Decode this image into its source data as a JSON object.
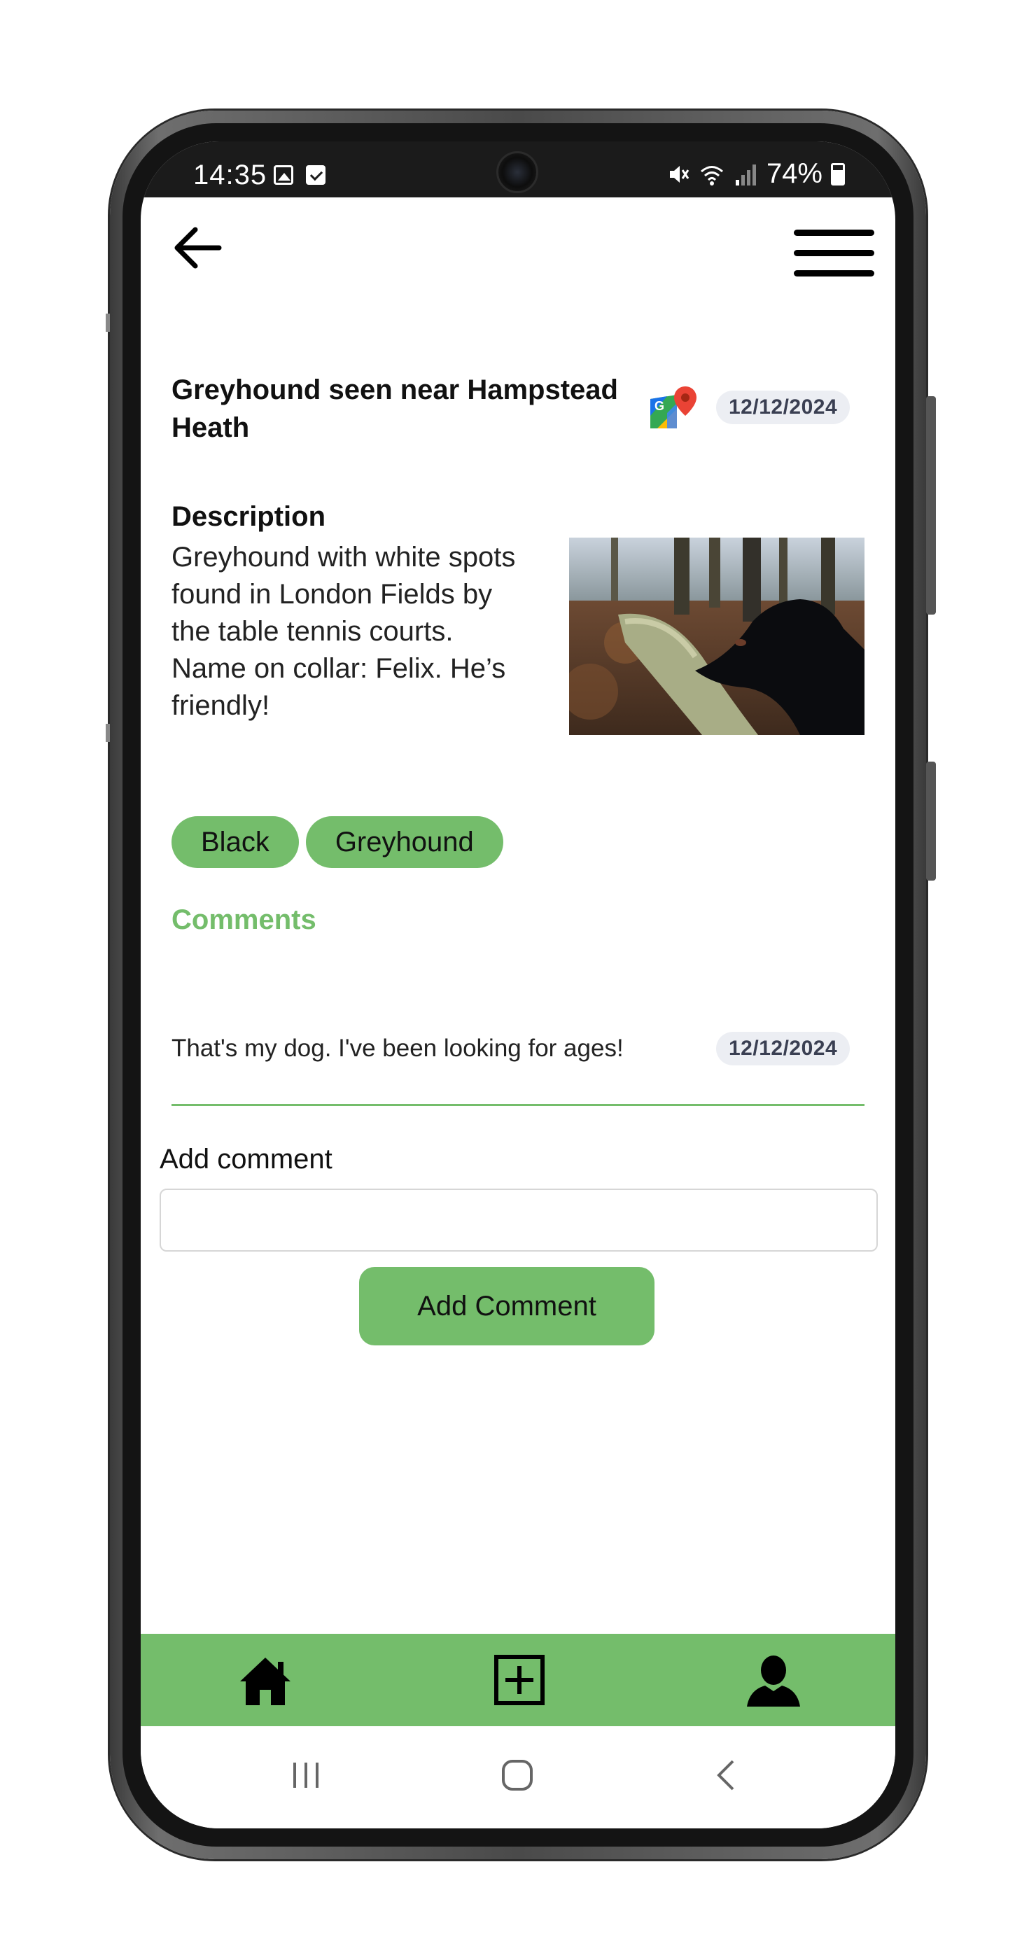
{
  "status_bar": {
    "time": "14:35",
    "battery": "74%"
  },
  "post": {
    "title": "Greyhound seen near Hampstead Heath",
    "date": "12/12/2024",
    "description_heading": "Description",
    "description": "Greyhound with white spots found in London Fields by the table tennis courts. Name on collar: Felix. He’s friendly!",
    "tags": [
      "Black",
      "Greyhound"
    ]
  },
  "comments": {
    "heading": "Comments",
    "items": [
      {
        "text": "That's my dog. I've been looking for ages!",
        "date": "12/12/2024"
      }
    ]
  },
  "add_comment": {
    "label": "Add comment",
    "value": "",
    "placeholder": "",
    "button_label": "Add Comment"
  },
  "icons": {
    "back": "arrow-left-icon",
    "menu": "hamburger-menu-icon",
    "map": "google-maps-icon",
    "nav_home": "home-icon",
    "nav_add": "plus-square-icon",
    "nav_profile": "user-icon"
  },
  "colors": {
    "accent": "#74bd6b",
    "badge_bg": "#eceef3",
    "badge_text": "#3a3f52"
  }
}
